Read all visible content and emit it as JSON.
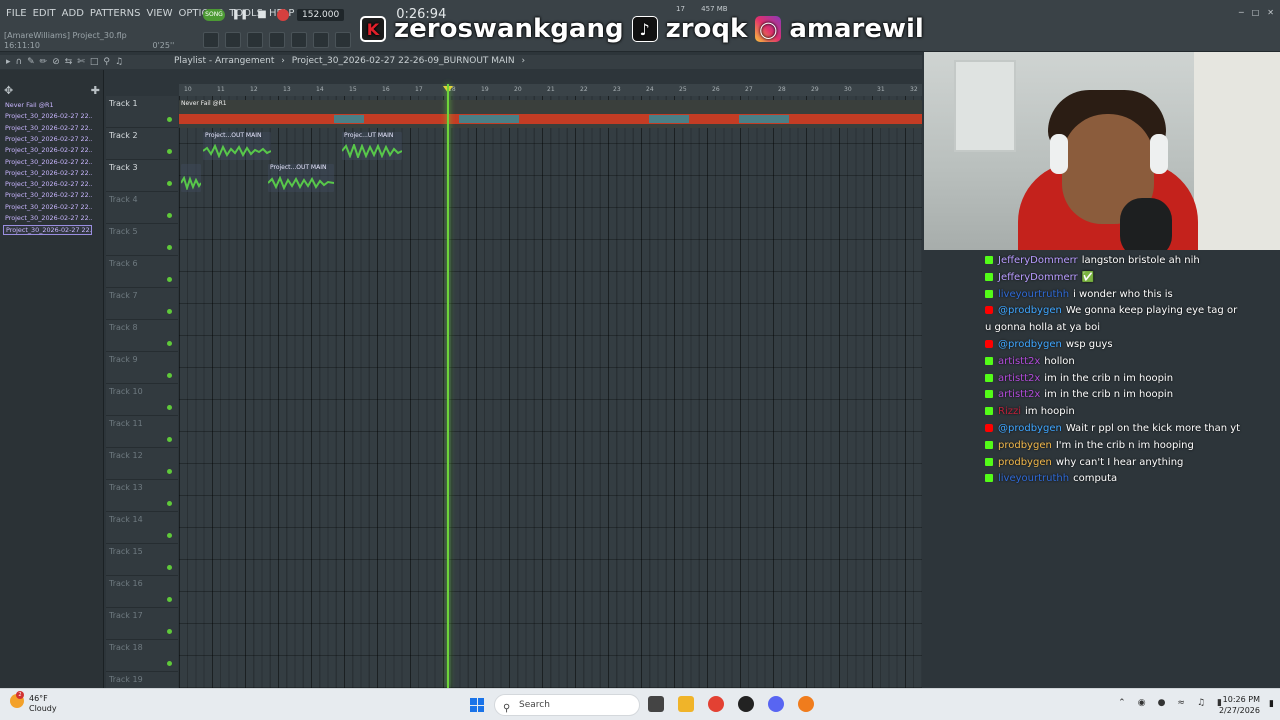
{
  "menu": [
    "FILE",
    "EDIT",
    "ADD",
    "PATTERNS",
    "VIEW",
    "OPTIONS",
    "TOOLS",
    "HELP"
  ],
  "project": {
    "owner": "[AmareWilliams]",
    "file": "Project_30.flp",
    "time": "16:11:10",
    "hint": "0'25''"
  },
  "transport": {
    "song_label": "SONG",
    "tempo": "152.000",
    "time_display": "0:26:94"
  },
  "memory": {
    "voices": "17",
    "mem": "457 MB"
  },
  "banner": {
    "kick_name": "zeroswankgang",
    "tiktok_name": "zroqk",
    "insta_name": "amarewil"
  },
  "playlist": {
    "title": "Playlist - Arrangement",
    "crumb": "Project_30_2026-02-27 22-26-09_BURNOUT MAIN"
  },
  "browser": {
    "patterns": [
      "Never Fail @R1",
      "Project_30_2026-02-27 22...",
      "Project_30_2026-02-27 22...",
      "Project_30_2026-02-27 22...",
      "Project_30_2026-02-27 22...",
      "Project_30_2026-02-27 22...",
      "Project_30_2026-02-27 22...",
      "Project_30_2026-02-27 22...",
      "Project_30_2026-02-27 22...",
      "Project_30_2026-02-27 22...",
      "Project_30_2026-02-27 22...",
      "Project_30_2026-02-27 22..."
    ]
  },
  "tracks": [
    "Track 1",
    "Track 2",
    "Track 3",
    "Track 4",
    "Track 5",
    "Track 6",
    "Track 7",
    "Track 8",
    "Track 9",
    "Track 10",
    "Track 11",
    "Track 12",
    "Track 13",
    "Track 14",
    "Track 15",
    "Track 16",
    "Track 17",
    "Track 18",
    "Track 19"
  ],
  "ruler": [
    "10",
    "11",
    "12",
    "13",
    "14",
    "15",
    "16",
    "17",
    "18",
    "19",
    "20",
    "21",
    "22",
    "23",
    "24",
    "25",
    "26",
    "27",
    "28",
    "29",
    "30",
    "31",
    "32"
  ],
  "clips": {
    "track1": "Never Fail @R1",
    "t2a": "Project...OUT MAIN",
    "t2b": "Projec...UT MAIN",
    "t3": "Project...OUT MAIN"
  },
  "chat": [
    {
      "user": "JefferyDommerr",
      "color": "#b99cff",
      "src": "kick",
      "text": "langston bristole ah nih"
    },
    {
      "user": "JefferyDommerr",
      "color": "#b99cff",
      "src": "kick",
      "text": "✅"
    },
    {
      "user": "liveyourtruthh",
      "color": "#2f6ad6",
      "src": "kick",
      "text": "i wonder who this is"
    },
    {
      "user": "@prodbygen",
      "color": "#3fa6ff",
      "src": "yt",
      "text": "We gonna keep playing eye tag or u gonna holla at ya boi"
    },
    {
      "user": "@prodbygen",
      "color": "#3fa6ff",
      "src": "yt",
      "text": "wsp guys"
    },
    {
      "user": "artistt2x",
      "color": "#b04bd8",
      "src": "kick",
      "text": "hollon"
    },
    {
      "user": "artistt2x",
      "color": "#b04bd8",
      "src": "kick",
      "text": "im in the crib n im hoopin"
    },
    {
      "user": "artistt2x",
      "color": "#b04bd8",
      "src": "kick",
      "text": "im in the crib n im hoopin"
    },
    {
      "user": "Rizzi",
      "color": "#c0203a",
      "src": "kick",
      "text": "im hoopin"
    },
    {
      "user": "@prodbygen",
      "color": "#3fa6ff",
      "src": "yt",
      "text": "Wait r ppl on the kick more than yt"
    },
    {
      "user": "prodbygen",
      "color": "#f2b84b",
      "src": "kick",
      "text": "I'm in the crib n im hooping"
    },
    {
      "user": "prodbygen",
      "color": "#f2b84b",
      "src": "kick",
      "text": "why can't I hear anything"
    },
    {
      "user": "liveyourtruthh",
      "color": "#2f6ad6",
      "src": "kick",
      "text": "computa"
    }
  ],
  "taskbar": {
    "weather_temp": "46°F",
    "weather_cond": "Cloudy",
    "weather_badge": "2",
    "search": "Search",
    "time": "10:26 PM",
    "date": "2/27/2026"
  }
}
